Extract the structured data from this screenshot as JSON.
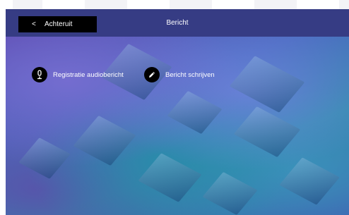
{
  "header": {
    "back_label": "Achteruit",
    "back_glyph": "<",
    "title": "Bericht"
  },
  "actions": [
    {
      "label": "Registratie audiobericht",
      "icon": "microphone-icon"
    },
    {
      "label": "Bericht schrijven",
      "icon": "pencil-icon"
    }
  ],
  "colors": {
    "topbar": "#363c84",
    "button_bg": "#000000",
    "text": "#ffffff"
  }
}
